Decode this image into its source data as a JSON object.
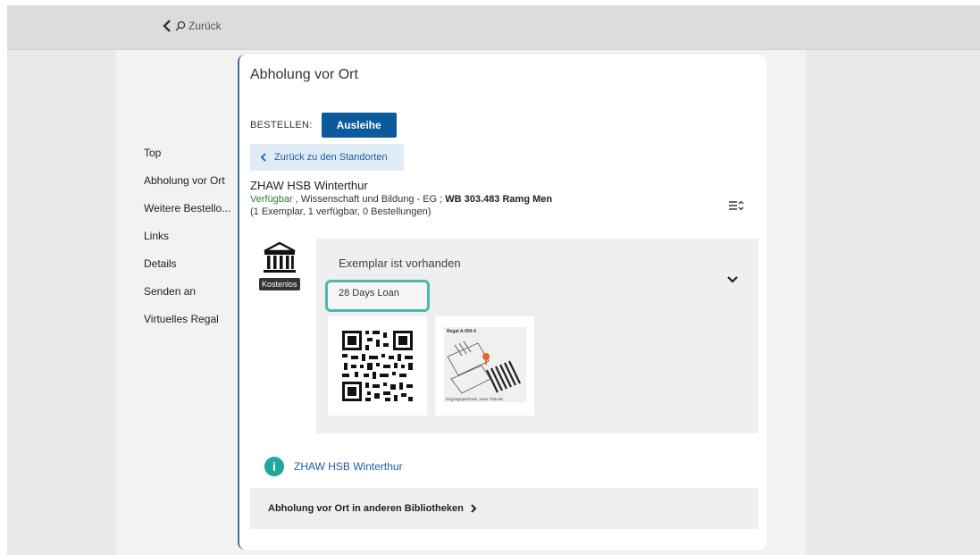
{
  "header": {
    "back_label": "Zurück"
  },
  "nav": {
    "items": [
      {
        "label": "Top"
      },
      {
        "label": "Abholung vor Ort"
      },
      {
        "label": "Weitere Bestello..."
      },
      {
        "label": "Links"
      },
      {
        "label": "Details"
      },
      {
        "label": "Senden an"
      },
      {
        "label": "Virtuelles Regal"
      }
    ]
  },
  "section": {
    "title": "Abholung vor Ort",
    "order_label": "BESTELLEN:",
    "order_button": "Ausleihe",
    "back_to_locations": "Zurück zu den Standorten"
  },
  "location": {
    "name": "ZHAW HSB Winterthur",
    "availability": "Verfügbar",
    "place": " , Wissenschaft und Bildung - EG ; ",
    "call_number": "WB 303.483 Ramg Men",
    "counts": "(1 Exemplar, 1 verfügbar, 0 Bestellungen)"
  },
  "item": {
    "badge": "Kostenlos",
    "title": "Exemplar ist vorhanden",
    "loan_policy": "28 Days Loan",
    "map_title": "Regal A-000-4",
    "map_caption": "Eingangsgeschoss, Haus Tisla Me"
  },
  "info_link": "ZHAW HSB Winterthur",
  "other_libraries": "Abholung vor Ort in anderen Bibliotheken",
  "colors": {
    "primary": "#0b5a9c",
    "link": "#1c5fa0",
    "available": "#2a7c3a",
    "highlight": "#4bb9a9",
    "info": "#20a69a"
  }
}
